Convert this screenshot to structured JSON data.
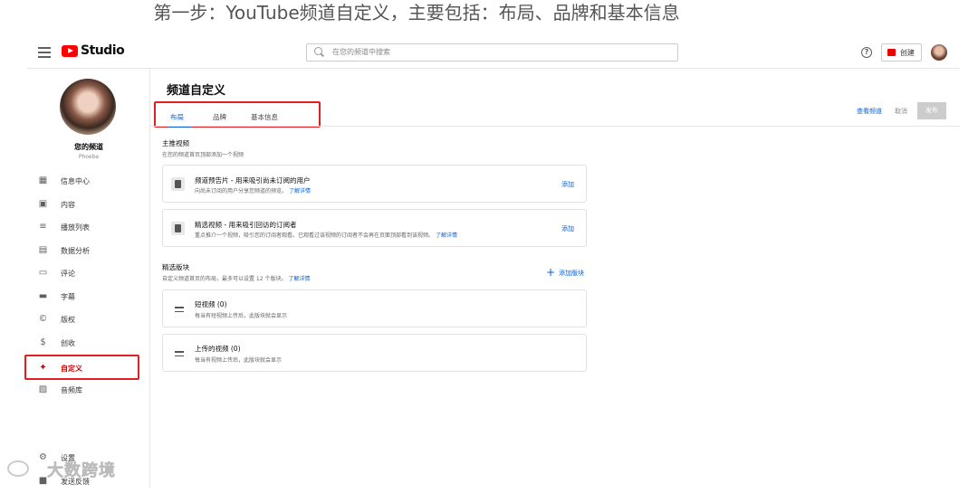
{
  "caption": "第一步：YouTube频道自定义，主要包括：布局、品牌和基本信息",
  "topbar": {
    "logo_text": "Studio",
    "search_placeholder": "在您的频道中搜索",
    "create_label": "创建"
  },
  "sidebar": {
    "channel_name": "您的频道",
    "channel_sub": "Phoebe",
    "items": [
      {
        "label": "信息中心",
        "icon": "dashboard-icon"
      },
      {
        "label": "内容",
        "icon": "content-icon"
      },
      {
        "label": "播放列表",
        "icon": "playlist-icon"
      },
      {
        "label": "数据分析",
        "icon": "analytics-icon"
      },
      {
        "label": "评论",
        "icon": "comments-icon"
      },
      {
        "label": "字幕",
        "icon": "subtitles-icon"
      },
      {
        "label": "版权",
        "icon": "copyright-icon"
      },
      {
        "label": "创收",
        "icon": "monetization-icon"
      },
      {
        "label": "自定义",
        "icon": "customization-icon"
      },
      {
        "label": "音频库",
        "icon": "audio-library-icon"
      }
    ],
    "settings_label": "设置",
    "feedback_label": "发送反馈"
  },
  "main": {
    "title": "频道自定义",
    "tabs": [
      {
        "label": "布局",
        "active": true
      },
      {
        "label": "品牌",
        "active": false
      },
      {
        "label": "基本信息",
        "active": false
      }
    ],
    "actions": {
      "view": "查看频道",
      "cancel": "取消",
      "publish": "发布"
    },
    "featured": {
      "title": "主推视频",
      "desc": "在您的频道首页顶部添加一个视频",
      "cards": [
        {
          "title": "频道预告片 - 用来吸引尚未订阅的用户",
          "desc": "向尚未订阅的用户分享您频道的预览。",
          "link": "了解详情",
          "add": "添加"
        },
        {
          "title": "精选视频 - 用来吸引回访的订阅者",
          "desc": "重点推介一个视频，吸引您的订阅者观看。已观看过该视频的订阅者不会再在页面顶部看到该视频。",
          "link": "了解详情",
          "add": "添加"
        }
      ]
    },
    "sections": {
      "title": "精选版块",
      "desc": "自定义频道首页的布局，最多可以设置 12 个版块。",
      "link": "了解详情",
      "add": "添加版块",
      "cards": [
        {
          "title": "短视频 (0)",
          "desc": "每当有短视频上传后，此版块就会显示"
        },
        {
          "title": "上传的视频 (0)",
          "desc": "每当有视频上传后，此版块就会显示"
        }
      ]
    }
  },
  "watermark": "大数跨境",
  "colors": {
    "accent": "#065fd4",
    "brand": "#ff0000",
    "highlight_box": "#e02020"
  }
}
